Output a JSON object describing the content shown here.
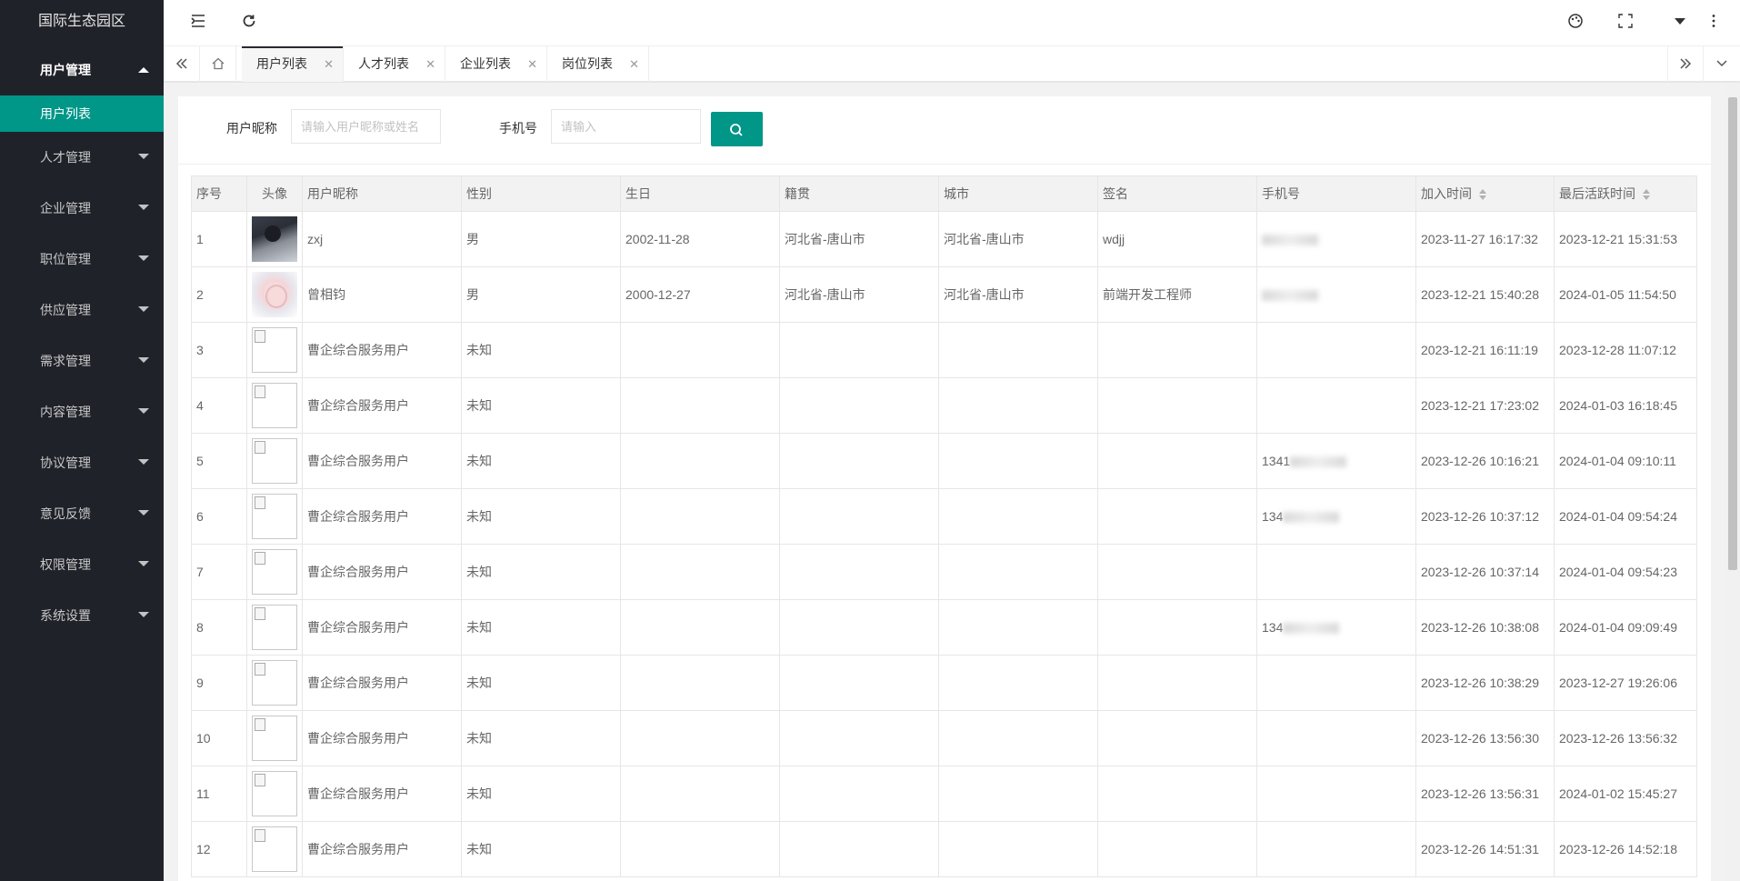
{
  "app": {
    "title": "国际生态园区"
  },
  "sidebar": {
    "items": [
      {
        "label": "用户管理",
        "open": true,
        "children": [
          {
            "label": "用户列表"
          }
        ]
      },
      {
        "label": "人才管理"
      },
      {
        "label": "企业管理"
      },
      {
        "label": "职位管理"
      },
      {
        "label": "供应管理"
      },
      {
        "label": "需求管理"
      },
      {
        "label": "内容管理"
      },
      {
        "label": "协议管理"
      },
      {
        "label": "意见反馈"
      },
      {
        "label": "权限管理"
      },
      {
        "label": "系统设置"
      }
    ]
  },
  "tabs": [
    {
      "label": "用户列表",
      "active": true
    },
    {
      "label": "人才列表"
    },
    {
      "label": "企业列表"
    },
    {
      "label": "岗位列表"
    }
  ],
  "filter": {
    "nickname_label": "用户昵称",
    "nickname_placeholder": "请输入用户昵称或姓名",
    "phone_label": "手机号",
    "phone_placeholder": "请输入"
  },
  "table": {
    "headers": [
      "序号",
      "头像",
      "用户昵称",
      "性别",
      "生日",
      "籍贯",
      "城市",
      "签名",
      "手机号",
      "加入时间",
      "最后活跃时间"
    ],
    "rows": [
      {
        "no": "1",
        "nickname": "zxj",
        "gender": "男",
        "birthday": "2002-11-28",
        "native": "河北省-唐山市",
        "city": "河北省-唐山市",
        "signature": "wdjj",
        "phone": "",
        "joined": "2023-11-27 16:17:32",
        "last_active": "2023-12-21 15:31:53"
      },
      {
        "no": "2",
        "nickname": "曾相钧",
        "gender": "男",
        "birthday": "2000-12-27",
        "native": "河北省-唐山市",
        "city": "河北省-唐山市",
        "signature": "前端开发工程师",
        "phone": "",
        "joined": "2023-12-21 15:40:28",
        "last_active": "2024-01-05 11:54:50"
      },
      {
        "no": "3",
        "nickname": "曹企综合服务用户",
        "gender": "未知",
        "birthday": "",
        "native": "",
        "city": "",
        "signature": "",
        "phone": "",
        "joined": "2023-12-21 16:11:19",
        "last_active": "2023-12-28 11:07:12"
      },
      {
        "no": "4",
        "nickname": "曹企综合服务用户",
        "gender": "未知",
        "birthday": "",
        "native": "",
        "city": "",
        "signature": "",
        "phone": "",
        "joined": "2023-12-21 17:23:02",
        "last_active": "2024-01-03 16:18:45"
      },
      {
        "no": "5",
        "nickname": "曹企综合服务用户",
        "gender": "未知",
        "birthday": "",
        "native": "",
        "city": "",
        "signature": "",
        "phone": "1341",
        "joined": "2023-12-26 10:16:21",
        "last_active": "2024-01-04 09:10:11"
      },
      {
        "no": "6",
        "nickname": "曹企综合服务用户",
        "gender": "未知",
        "birthday": "",
        "native": "",
        "city": "",
        "signature": "",
        "phone": "134",
        "joined": "2023-12-26 10:37:12",
        "last_active": "2024-01-04 09:54:24"
      },
      {
        "no": "7",
        "nickname": "曹企综合服务用户",
        "gender": "未知",
        "birthday": "",
        "native": "",
        "city": "",
        "signature": "",
        "phone": "",
        "joined": "2023-12-26 10:37:14",
        "last_active": "2024-01-04 09:54:23"
      },
      {
        "no": "8",
        "nickname": "曹企综合服务用户",
        "gender": "未知",
        "birthday": "",
        "native": "",
        "city": "",
        "signature": "",
        "phone": "134",
        "joined": "2023-12-26 10:38:08",
        "last_active": "2024-01-04 09:09:49"
      },
      {
        "no": "9",
        "nickname": "曹企综合服务用户",
        "gender": "未知",
        "birthday": "",
        "native": "",
        "city": "",
        "signature": "",
        "phone": "",
        "joined": "2023-12-26 10:38:29",
        "last_active": "2023-12-27 19:26:06"
      },
      {
        "no": "10",
        "nickname": "曹企综合服务用户",
        "gender": "未知",
        "birthday": "",
        "native": "",
        "city": "",
        "signature": "",
        "phone": "",
        "joined": "2023-12-26 13:56:30",
        "last_active": "2023-12-26 13:56:32"
      },
      {
        "no": "11",
        "nickname": "曹企综合服务用户",
        "gender": "未知",
        "birthday": "",
        "native": "",
        "city": "",
        "signature": "",
        "phone": "",
        "joined": "2023-12-26 13:56:31",
        "last_active": "2024-01-02 15:45:27"
      },
      {
        "no": "12",
        "nickname": "曹企综合服务用户",
        "gender": "未知",
        "birthday": "",
        "native": "",
        "city": "",
        "signature": "",
        "phone": "",
        "joined": "2023-12-26 14:51:31",
        "last_active": "2023-12-26 14:52:18"
      }
    ]
  },
  "colors": {
    "accent": "#009688",
    "sidebar_bg": "#20222a"
  }
}
